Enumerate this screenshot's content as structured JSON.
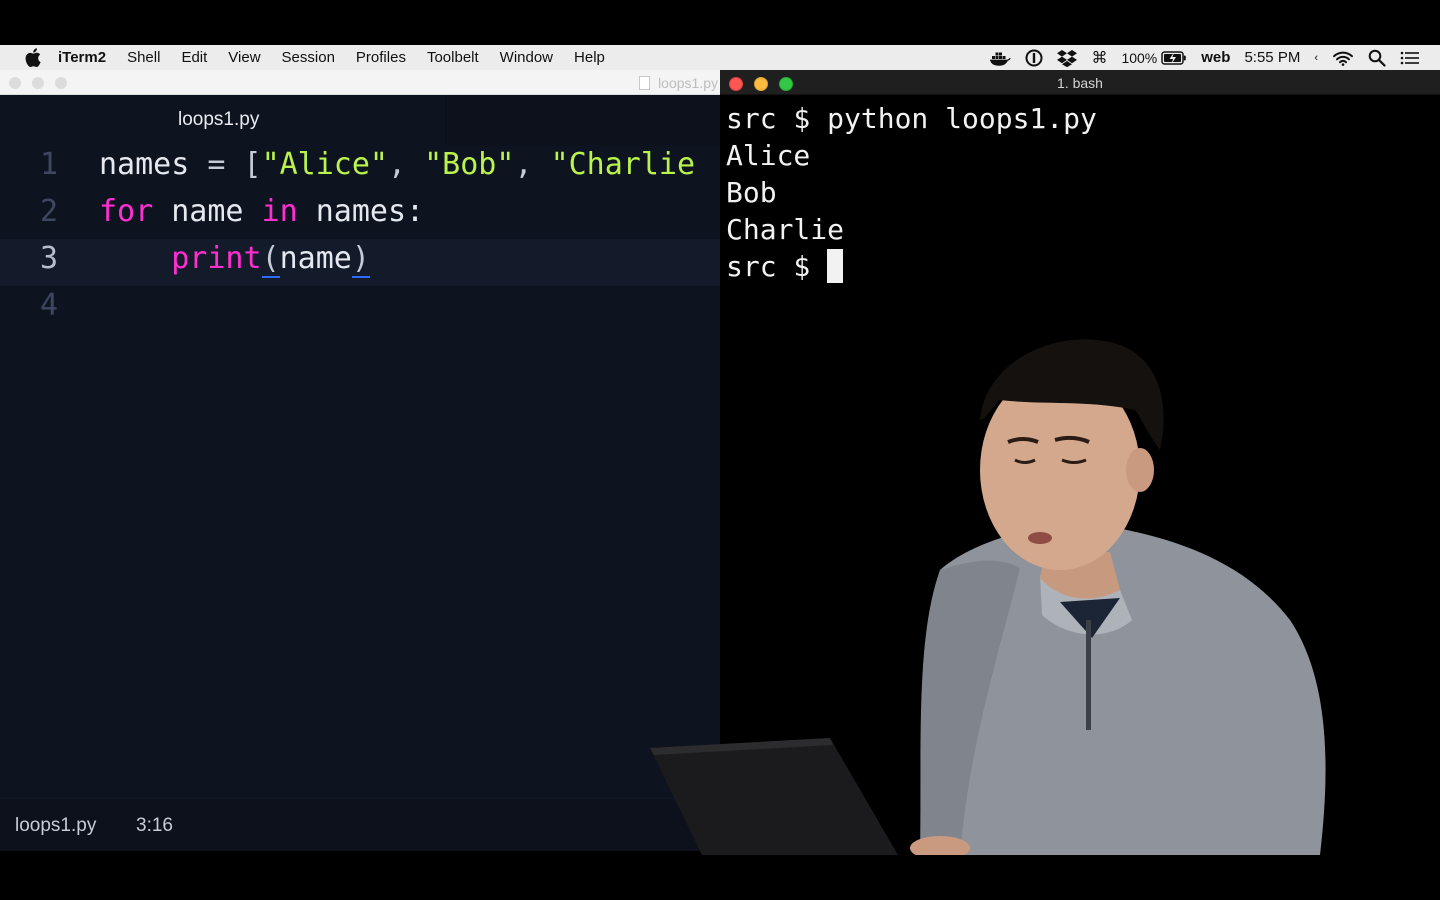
{
  "menubar": {
    "app_name": "iTerm2",
    "menus": [
      "Shell",
      "Edit",
      "View",
      "Session",
      "Profiles",
      "Toolbelt",
      "Window",
      "Help"
    ],
    "battery": "100%",
    "user": "web",
    "time": "5:55 PM",
    "icons": [
      "apple-icon",
      "docker-icon",
      "1password-icon",
      "dropbox-icon",
      "command-icon",
      "battery-charging-icon",
      "back-chevron-icon",
      "wifi-icon",
      "spotlight-search-icon",
      "notification-center-icon"
    ]
  },
  "editor": {
    "window_title": "loops1.py",
    "tab_label": "loops1.py",
    "lines": [
      {
        "number": "1"
      },
      {
        "number": "2"
      },
      {
        "number": "3"
      },
      {
        "number": "4"
      }
    ],
    "code": {
      "l1_var": "names",
      "l1_eq": " = ",
      "l1_open": "[",
      "l1_s1": "\"Alice\"",
      "l1_c1": ", ",
      "l1_s2": "\"Bob\"",
      "l1_c2": ", ",
      "l1_s3": "\"Charlie",
      "l2_for": "for",
      "l2_name": " name ",
      "l2_in": "in",
      "l2_names": " names:",
      "l3_indent": "    ",
      "l3_fn": "print",
      "l3_open": "(",
      "l3_arg": "name",
      "l3_close": ")"
    },
    "status_file": "loops1.py",
    "status_position": "3:16",
    "colors": {
      "keyword": "#ff2ed1",
      "string": "#b9f34b",
      "background": "#0e1320"
    }
  },
  "terminal": {
    "title": "1. bash",
    "lines": [
      "src $ python loops1.py",
      "Alice",
      "Bob",
      "Charlie"
    ],
    "prompt": "src $ "
  }
}
